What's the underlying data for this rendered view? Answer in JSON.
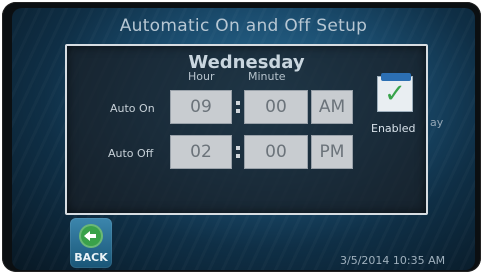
{
  "header": {
    "title": "Automatic On and Off Setup"
  },
  "dialog": {
    "day": "Wednesday",
    "columns": {
      "hour": "Hour",
      "minute": "Minute"
    },
    "rows": [
      {
        "label": "Auto On",
        "hour": "09",
        "minute": "00",
        "ampm": "AM"
      },
      {
        "label": "Auto Off",
        "hour": "02",
        "minute": "00",
        "ampm": "PM"
      }
    ],
    "enabled": {
      "label": "Enabled",
      "checked": true,
      "icon": "check-icon"
    }
  },
  "background": {
    "stray_text": "ay"
  },
  "footer": {
    "back_label": "BACK",
    "back_icon": "back-arrow-icon",
    "timestamp": "3/5/2014 10:35 AM"
  }
}
